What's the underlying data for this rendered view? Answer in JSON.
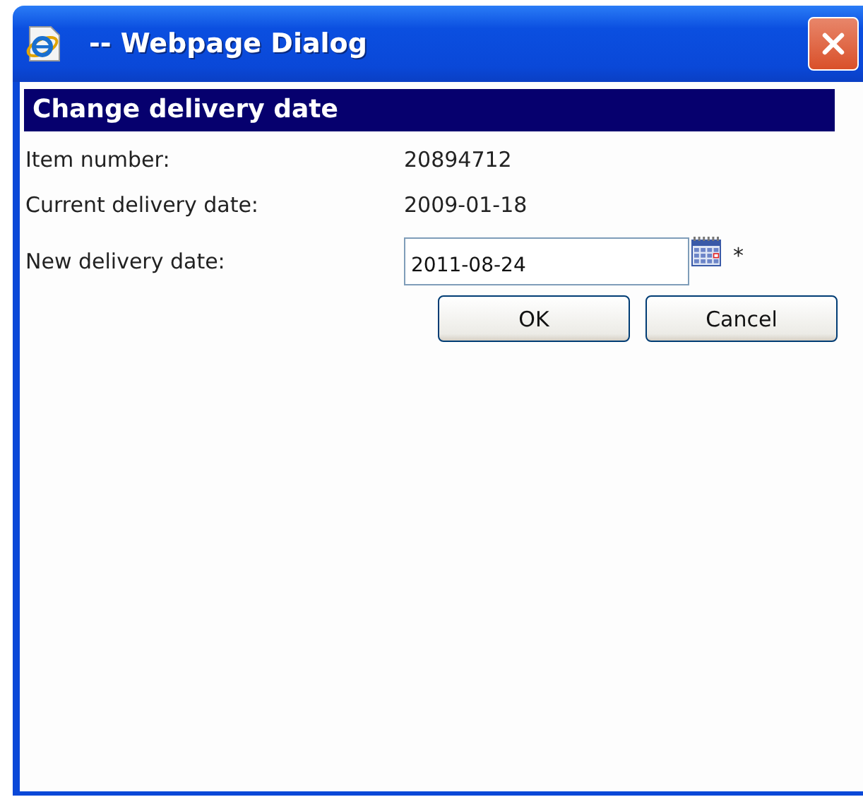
{
  "window": {
    "title": "-- Webpage Dialog"
  },
  "heading": "Change delivery date",
  "fields": [
    {
      "kind": "text",
      "label": "Item number:",
      "value": "20894712"
    },
    {
      "kind": "text",
      "label": "Current delivery date:",
      "value": "2009-01-18"
    },
    {
      "kind": "date",
      "label": "New delivery date:",
      "value": "2011-08-24",
      "required_mark": "*"
    }
  ],
  "buttons": [
    "OK",
    "Cancel"
  ]
}
